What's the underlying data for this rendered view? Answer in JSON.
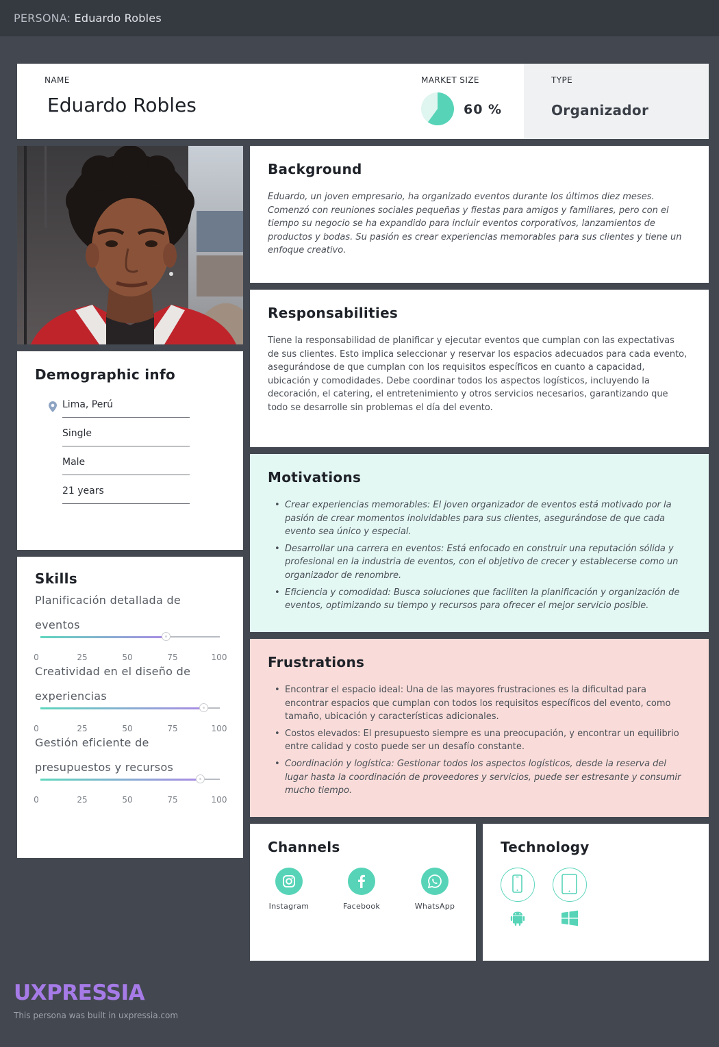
{
  "topbar": {
    "prefix": "PERSONA:",
    "name": "Eduardo Robles"
  },
  "header": {
    "name_label": "NAME",
    "name": "Eduardo Robles",
    "market_size_label": "MARKET SIZE",
    "market_size_value": "60 %",
    "market_size_fraction": 0.6,
    "type_label": "TYPE",
    "type": "Organizador"
  },
  "background": {
    "title": "Background",
    "text": "Eduardo, un joven empresario, ha organizado eventos durante los últimos diez meses. Comenzó con reuniones sociales pequeñas y fiestas para amigos y familiares, pero con el tiempo su negocio se ha expandido para incluir eventos corporativos, lanzamientos de productos y bodas. Su pasión es crear experiencias memorables para sus clientes y tiene un enfoque creativo."
  },
  "responsibilities": {
    "title": "Responsabilities",
    "text": "Tiene la responsabilidad de planificar y ejecutar eventos que cumplan con las expectativas de sus clientes. Esto implica seleccionar y reservar los espacios adecuados para cada evento, asegurándose de que cumplan con los requisitos específicos en cuanto a capacidad, ubicación y comodidades. Debe coordinar todos los aspectos logísticos, incluyendo la decoración, el catering, el entretenimiento y otros servicios necesarios, garantizando que todo se desarrolle sin problemas el día del evento."
  },
  "demographic": {
    "title": "Demographic info",
    "location": "Lima, Perú",
    "status": "Single",
    "gender": "Male",
    "age": "21 years"
  },
  "skills": {
    "title": "Skills",
    "ticks": [
      "0",
      "25",
      "50",
      "75",
      "100"
    ],
    "items": [
      {
        "name": "Planificación detallada de eventos",
        "value": 70
      },
      {
        "name": "Creatividad en el diseño de experiencias",
        "value": 91
      },
      {
        "name": "Gestión eficiente de presupuestos y recursos",
        "value": 89
      }
    ]
  },
  "motivations": {
    "title": "Motivations",
    "items": [
      "Crear experiencias memorables: El joven organizador de eventos está motivado por la pasión de crear momentos inolvidables para sus clientes, asegurándose de que cada evento sea único y especial.",
      "Desarrollar una carrera en eventos: Está enfocado en construir una reputación sólida y profesional en la industria de eventos, con el objetivo de crecer y establecerse como un organizador de renombre.",
      "Eficiencia y comodidad: Busca soluciones que faciliten la planificación y organización de eventos, optimizando su tiempo y recursos para ofrecer el mejor servicio posible."
    ]
  },
  "frustrations": {
    "title": "Frustrations",
    "items": [
      "Encontrar el espacio ideal: Una de las mayores frustraciones es la dificultad para encontrar espacios que cumplan con todos los requisitos específicos del evento, como tamaño, ubicación y características adicionales.",
      "Costos elevados: El presupuesto siempre es una preocupación, y encontrar un equilibrio entre calidad y costo puede ser un desafío constante.",
      "Coordinación y logística: Gestionar todos los aspectos logísticos, desde la reserva del lugar hasta la coordinación de proveedores y servicios, puede ser estresante y consumir mucho tiempo."
    ]
  },
  "channels": {
    "title": "Channels",
    "items": [
      {
        "label": "Instagram",
        "icon": "instagram-icon"
      },
      {
        "label": "Facebook",
        "icon": "facebook-icon"
      },
      {
        "label": "WhatsApp",
        "icon": "whatsapp-icon"
      }
    ]
  },
  "technology": {
    "title": "Technology",
    "devices": [
      "smartphone-icon",
      "tablet-icon"
    ],
    "os": [
      "android-icon",
      "windows-icon"
    ]
  },
  "footer": {
    "brand": "UXPRESSIA",
    "note": "This persona was built in uxpressia.com"
  },
  "colors": {
    "accent": "#57d4b8",
    "motivations_bg": "#e3f7f3",
    "frustrations_bg": "#f9dcd9",
    "brand": "#a67be8",
    "background": "#434850"
  }
}
